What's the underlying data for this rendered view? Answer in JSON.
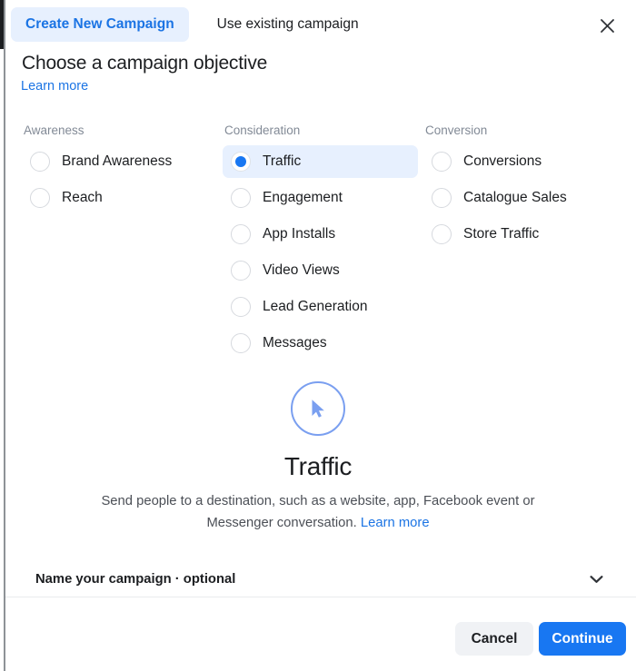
{
  "window": {
    "left_edge_color": "#1c1e21"
  },
  "header": {
    "tabs": [
      {
        "label": "Create New Campaign",
        "active": true,
        "name": "tab-create-new-campaign"
      },
      {
        "label": "Use existing campaign",
        "active": false,
        "name": "tab-use-existing-campaign"
      }
    ],
    "close_icon": "close-icon",
    "active_tab_bg": "#e7f0fe",
    "active_tab_color": "#1b74e4"
  },
  "body": {
    "title": "Choose a campaign objective",
    "learn_more": "Learn more"
  },
  "columns": [
    {
      "title": "Awareness",
      "name": "column-awareness",
      "options": [
        {
          "label": "Brand Awareness",
          "selected": false
        },
        {
          "label": "Reach",
          "selected": false
        }
      ]
    },
    {
      "title": "Consideration",
      "name": "column-consideration",
      "options": [
        {
          "label": "Traffic",
          "selected": true
        },
        {
          "label": "Engagement",
          "selected": false
        },
        {
          "label": "App Installs",
          "selected": false
        },
        {
          "label": "Video Views",
          "selected": false
        },
        {
          "label": "Lead Generation",
          "selected": false
        },
        {
          "label": "Messages",
          "selected": false
        }
      ]
    },
    {
      "title": "Conversion",
      "name": "column-conversion",
      "options": [
        {
          "label": "Conversions",
          "selected": false
        },
        {
          "label": "Catalogue Sales",
          "selected": false
        },
        {
          "label": "Store Traffic",
          "selected": false
        }
      ]
    }
  ],
  "preview": {
    "icon": "cursor-pointer-icon",
    "icon_color": "#7a9ff0",
    "title": "Traffic",
    "description": "Send people to a destination, such as a website, app, Facebook event or Messenger conversation.",
    "description_link": "Learn more"
  },
  "name_campaign": {
    "label": "Name your campaign · optional",
    "chevron_icon": "chevron-down-icon"
  },
  "footer": {
    "cancel_label": "Cancel",
    "continue_label": "Continue",
    "continue_bg": "#1877f2",
    "cancel_bg": "#f0f2f5"
  },
  "colors": {
    "accent": "#1877f2",
    "link": "#1b74e4",
    "highlight": "#e7f0fe",
    "text": "#1c1e21",
    "muted": "#828a96"
  }
}
